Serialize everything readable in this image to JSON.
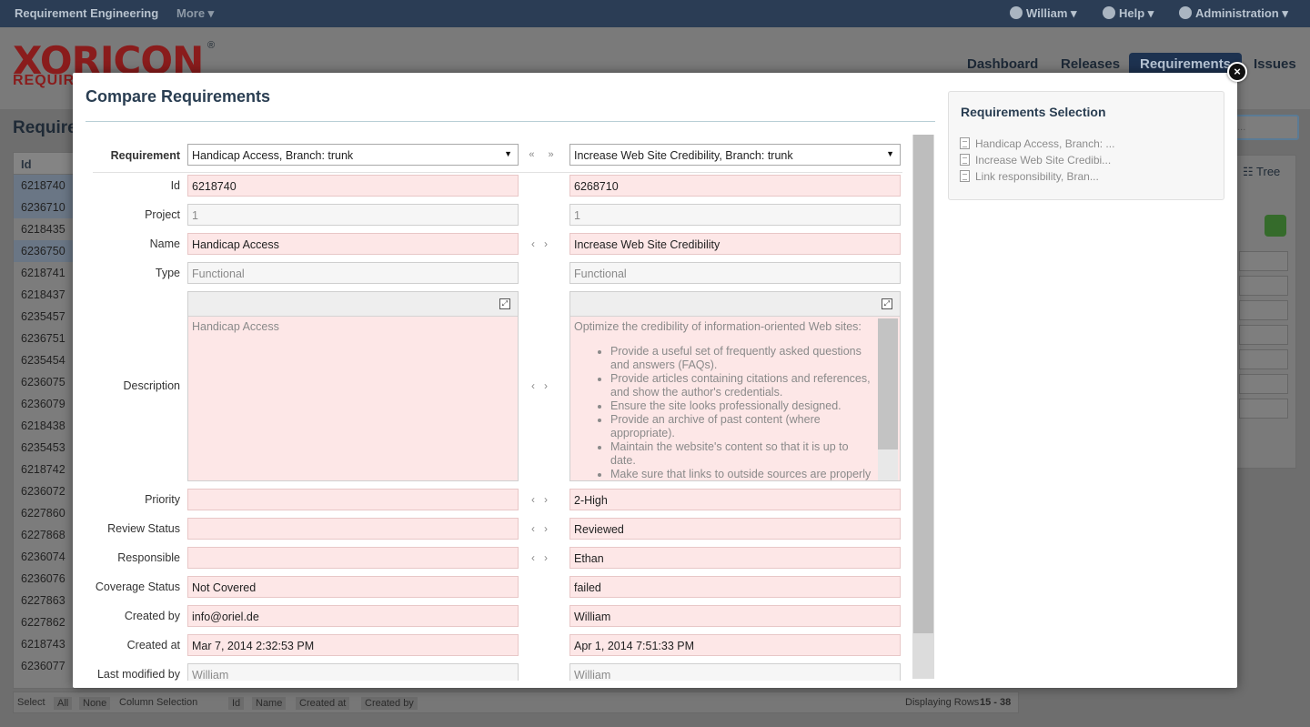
{
  "topbar": {
    "brand": "Requirement Engineering",
    "more": "More",
    "user": "William",
    "help": "Help",
    "admin": "Administration"
  },
  "header": {
    "logo_main": "XORICON",
    "logo_sub": "REQUIR",
    "tabs": [
      "Dashboard",
      "Releases",
      "Requirements",
      "Issues"
    ]
  },
  "background": {
    "title": "Require",
    "column_id": "Id",
    "ids": [
      "6218740",
      "6236710",
      "6218435",
      "6236750",
      "6218741",
      "6218437",
      "6235457",
      "6236751",
      "6235454",
      "6236075",
      "6236079",
      "6218438",
      "6235453",
      "6218742",
      "6236072",
      "6227860",
      "6227868",
      "6236074",
      "6236076",
      "6227863",
      "6227862",
      "6218743",
      "6236077"
    ],
    "tree": "Tree",
    "footer": {
      "select": "Select",
      "all": "All",
      "none": "None",
      "column_selection": "Column Selection",
      "col_id": "Id",
      "col_name": "Name",
      "col_created_at": "Created at",
      "col_created_by": "Created by",
      "displaying": "Displaying Rows",
      "range": "15 - 38"
    }
  },
  "modal": {
    "title": "Compare Requirements",
    "close": "×",
    "selection_panel": {
      "title": "Requirements Selection",
      "items": [
        "Handicap Access, Branch: ...",
        "Increase Web Site Credibi...",
        "Link responsibility, Bran..."
      ]
    },
    "requirement": {
      "label": "Requirement",
      "left": "Handicap Access, Branch: trunk",
      "right": "Increase Web Site Credibility, Branch: trunk"
    },
    "fields": {
      "id": {
        "label": "Id",
        "left": "6218740",
        "right": "6268710"
      },
      "project": {
        "label": "Project",
        "left": "1",
        "right": "1"
      },
      "name": {
        "label": "Name",
        "left": "Handicap Access",
        "right": "Increase Web Site Credibility"
      },
      "type": {
        "label": "Type",
        "left": "Functional",
        "right": "Functional"
      },
      "description": {
        "label": "Description",
        "left": "Handicap Access",
        "right_intro": "Optimize the credibility of information-oriented Web sites:",
        "right_items": [
          "Provide a useful set of frequently asked questions and answers (FAQs).",
          "Provide articles containing citations and references, and show the author's credentials.",
          "Ensure the site looks professionally designed.",
          "Provide an archive of past content (where appropriate).",
          "Maintain the website's content so that it is up to date.",
          "Make sure that links to outside sources are properly"
        ]
      },
      "priority": {
        "label": "Priority",
        "left": "",
        "right": "2-High"
      },
      "review_status": {
        "label": "Review Status",
        "left": "",
        "right": "Reviewed"
      },
      "responsible": {
        "label": "Responsible",
        "left": "",
        "right": "Ethan"
      },
      "coverage_status": {
        "label": "Coverage Status",
        "left": "Not Covered",
        "right": "failed"
      },
      "created_by": {
        "label": "Created by",
        "left": "info@oriel.de",
        "right": "William"
      },
      "created_at": {
        "label": "Created at",
        "left": "Mar 7, 2014 2:32:53 PM",
        "right": "Apr 1, 2014 7:51:33 PM"
      },
      "last_modified_by": {
        "label": "Last modified by",
        "left": "William",
        "right": "William"
      }
    }
  },
  "colors": {
    "topbar": "#2b3d55",
    "diff_bg": "#fde7e7",
    "title": "#2a3e52"
  }
}
